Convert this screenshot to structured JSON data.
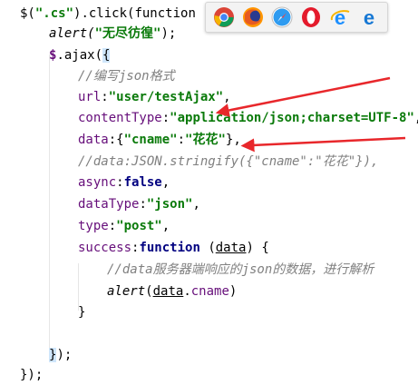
{
  "code": {
    "l1": {
      "a": "$(",
      "b": "\".cs\"",
      "c": ").click(",
      "d": "function",
      "e": " () {"
    },
    "l2": {
      "a": "alert(",
      "b": "\"无尽彷徨\"",
      "c": ");"
    },
    "l3": {
      "a": "$",
      "b": ".ajax(",
      "c": "{"
    },
    "l4": "//编写json格式",
    "l5": {
      "a": "url",
      "b": ":",
      "c": "\"user/testAjax\"",
      "d": ","
    },
    "l6": {
      "a": "contentType",
      "b": ":",
      "c": "\"application/json;charset=UTF-8\"",
      "d": ","
    },
    "l7": {
      "a": "data",
      "b": ":{",
      "c": "\"cname\"",
      "d": ":",
      "e": "\"花花\"",
      "f": "},"
    },
    "l8": "//data:JSON.stringify({\"cname\":\"花花\"}),",
    "l9": {
      "a": "async",
      "b": ":",
      "c": "false",
      "d": ","
    },
    "l10": {
      "a": "dataType",
      "b": ":",
      "c": "\"json\"",
      "d": ","
    },
    "l11": {
      "a": "type",
      "b": ":",
      "c": "\"post\"",
      "d": ","
    },
    "l12": {
      "a": "success",
      "b": ":",
      "c": "function",
      "d": " (",
      "e": "data",
      "f": ") {"
    },
    "l13": "//data服务器端响应的json的数据，进行解析",
    "l14": {
      "a": "alert",
      "b": "(",
      "c": "data",
      "d": ".",
      "e": "cname",
      "f": ")"
    },
    "l15": "}",
    "l17": {
      "a": "}",
      "b": ");"
    },
    "l18": "});"
  },
  "browsers": [
    "chrome-icon",
    "firefox-icon",
    "safari-icon",
    "opera-icon",
    "ie-icon",
    "edge-icon"
  ],
  "colors": {
    "string": "#0a7a0a",
    "keyword": "#000080",
    "property": "#660e7a",
    "comment": "#808080",
    "arrow": "#e8272b",
    "highlight": "#cfe6fb"
  }
}
